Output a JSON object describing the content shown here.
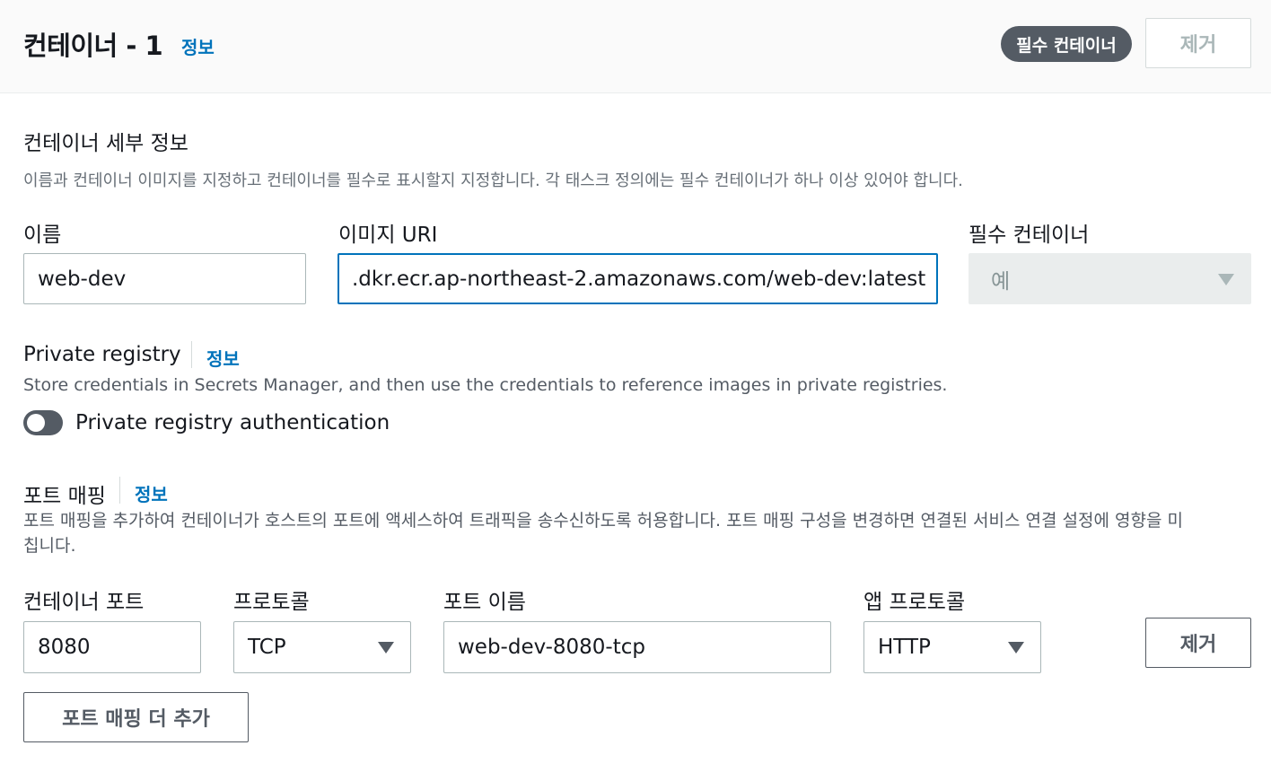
{
  "header": {
    "title": "컨테이너 - 1",
    "info": "정보",
    "badge": "필수 컨테이너",
    "remove_label": "제거"
  },
  "details": {
    "title": "컨테이너 세부 정보",
    "description": "이름과 컨테이너 이미지를 지정하고 컨테이너를 필수로 표시할지 지정합니다. 각 태스크 정의에는 필수 컨테이너가 하나 이상 있어야 합니다.",
    "name_label": "이름",
    "name_value": "web-dev",
    "image_label": "이미지 URI",
    "image_value": ".dkr.ecr.ap-northeast-2.amazonaws.com/web-dev:latest",
    "essential_label": "필수 컨테이너",
    "essential_value": "예"
  },
  "private_registry": {
    "title": "Private registry",
    "info": "정보",
    "description": "Store credentials in Secrets Manager, and then use the credentials to reference images in private registries.",
    "toggle_label": "Private registry authentication",
    "enabled": false
  },
  "port_mapping": {
    "title": "포트 매핑",
    "info": "정보",
    "description_line1": "포트 매핑을 추가하여 컨테이너가 호스트의 포트에 액세스하여 트래픽을 송수신하도록 허용합니다. 포트 매핑 구성을 변경하면 연결된 서비스 연결 설정에 영향을 미",
    "description_line2": "칩니다.",
    "container_port_label": "컨테이너 포트",
    "container_port_value": "8080",
    "protocol_label": "프로토콜",
    "protocol_value": "TCP",
    "port_name_label": "포트 이름",
    "port_name_value": "web-dev-8080-tcp",
    "app_protocol_label": "앱 프로토콜",
    "app_protocol_value": "HTTP",
    "remove_label": "제거",
    "add_label": "포트 매핑 더 추가"
  },
  "colors": {
    "link": "#0073bb",
    "badge_bg": "#545b64",
    "focus_border": "#0073bb"
  }
}
